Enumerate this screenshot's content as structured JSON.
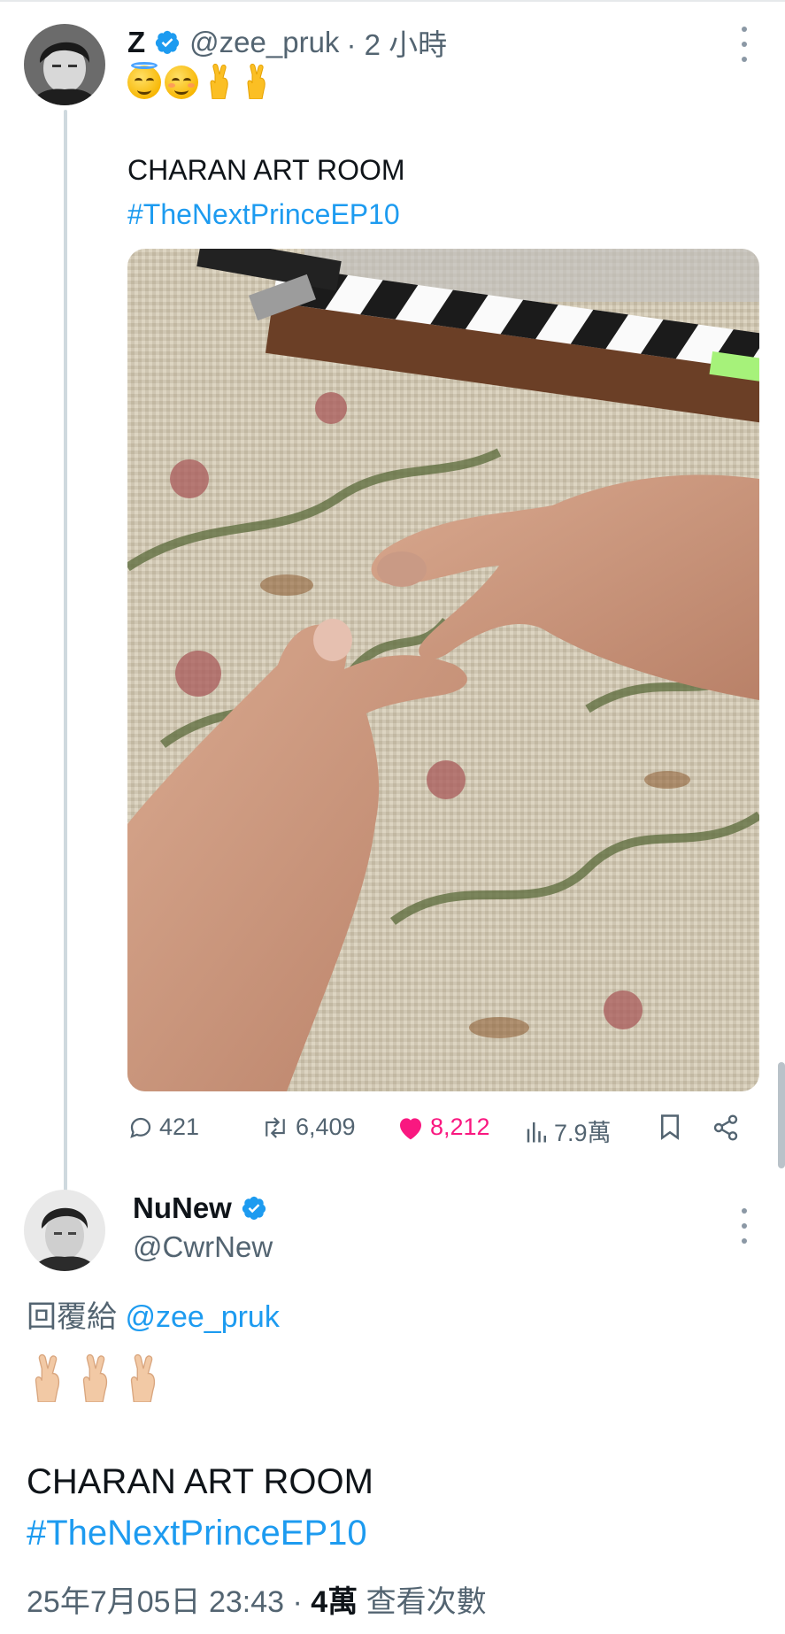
{
  "tweet": {
    "author": {
      "display_name": "Z",
      "handle": "@zee_pruk",
      "time": "· 2 小時",
      "avatar": "avatar-photo"
    },
    "emojis": [
      "smiling-face-with-halo-icon",
      "relieved-face-icon",
      "crossed-fingers-icon",
      "crossed-fingers-icon"
    ],
    "text_line1": "CHARAN ART ROOM",
    "hashtag": "#TheNextPrinceEP10",
    "media_description": "photo-of-hands-with-clapperboard",
    "stats": {
      "replies": "421",
      "reposts": "6,409",
      "likes": "8,212",
      "views": "7.9萬"
    }
  },
  "reply": {
    "author": {
      "display_name": "NuNew",
      "handle": "@CwrNew",
      "avatar": "avatar-photo"
    },
    "reply_to_label": "回覆給",
    "reply_to_handle": "@zee_pruk",
    "emojis": [
      "crossed-fingers-light-skin-icon",
      "crossed-fingers-light-skin-icon",
      "crossed-fingers-light-skin-icon"
    ],
    "text_line1": "CHARAN ART ROOM",
    "hashtag": "#TheNextPrinceEP10",
    "timestamp": "25年7月05日 23:43 · ",
    "views_count": "4萬",
    "views_label": " 查看次數"
  },
  "colors": {
    "accent": "#1d9bf0",
    "like": "#f91880",
    "muted": "#536471",
    "text": "#0f1419"
  }
}
